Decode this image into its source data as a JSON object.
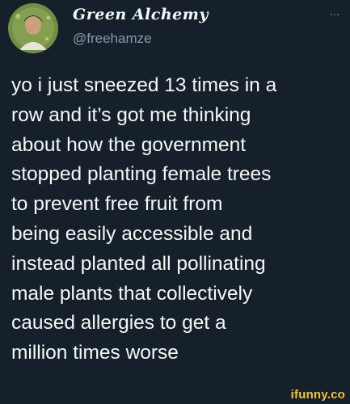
{
  "tweet": {
    "display_name": "Green Alchemy",
    "handle": "@freehamze",
    "more_icon": "…",
    "text": "yo i just sneezed 13 times in a\nrow and it’s got me thinking\nabout how the government\nstopped planting female trees\nto prevent free fruit from\nbeing easily accessible and\ninstead planted all pollinating\nmale plants that collectively\ncaused allergies to get a\nmillion times worse"
  },
  "watermark": {
    "text": "ifunny.co"
  },
  "colors": {
    "background": "#15202b",
    "text": "#f7f9f9",
    "secondary": "#8b98a5",
    "watermark": "#f3c623"
  },
  "icons": {
    "avatar": "avatar-image",
    "more": "more-options-icon"
  }
}
